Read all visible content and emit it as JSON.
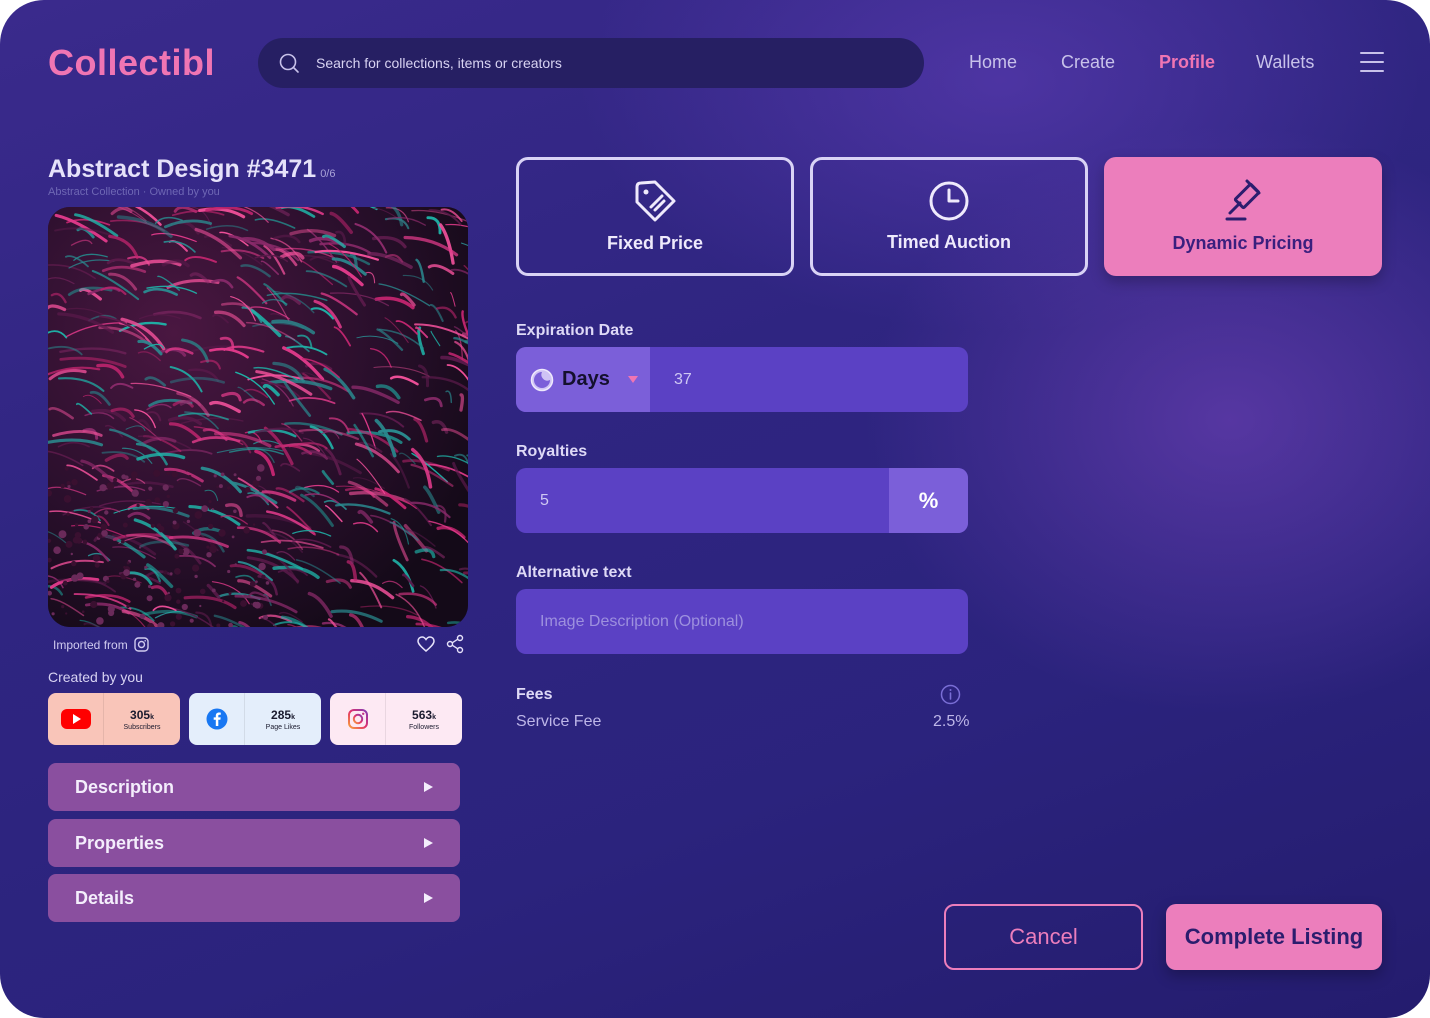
{
  "header": {
    "logo": "Collectibl",
    "search_placeholder": "Search for collections, items or creators",
    "nav": [
      {
        "label": "Home",
        "active": false
      },
      {
        "label": "Create",
        "active": false
      },
      {
        "label": "Profile",
        "active": true
      },
      {
        "label": "Wallets",
        "active": false
      }
    ]
  },
  "item": {
    "title": "Abstract Design #3471",
    "edition": "0/6",
    "subtitle": "Abstract Collection · Owned by you",
    "imported_from": "Imported from",
    "created_by": "Created by you"
  },
  "socials": [
    {
      "platform": "youtube-icon",
      "count": "305",
      "suffix": "k",
      "label": "Subscribers",
      "bg": "#f9c5b9"
    },
    {
      "platform": "facebook-icon",
      "count": "285",
      "suffix": "k",
      "label": "Page Likes",
      "bg": "#e4eefb"
    },
    {
      "platform": "instagram-icon",
      "count": "563",
      "suffix": "k",
      "label": "Followers",
      "bg": "#fde9f3"
    }
  ],
  "accordion": [
    "Description",
    "Properties",
    "Details"
  ],
  "pricing_options": [
    {
      "label": "Fixed Price",
      "icon": "price-tag-icon",
      "active": false
    },
    {
      "label": "Timed Auction",
      "icon": "clock-icon",
      "active": false
    },
    {
      "label": "Dynamic Pricing",
      "icon": "gavel-icon",
      "active": true
    }
  ],
  "form": {
    "expiration_label": "Expiration Date",
    "expiration_unit": "Days",
    "expiration_value": "37",
    "royalties_label": "Royalties",
    "royalties_value": "5",
    "royalties_unit": "%",
    "alt_label": "Alternative text",
    "alt_placeholder": "Image Description (Optional)",
    "fees_label": "Fees",
    "service_fee_label": "Service Fee",
    "service_fee_value": "2.5%"
  },
  "actions": {
    "cancel": "Cancel",
    "complete": "Complete Listing"
  },
  "colors": {
    "accent": "#f075b3",
    "background": "#2f2581",
    "field": "#5b41c4"
  }
}
